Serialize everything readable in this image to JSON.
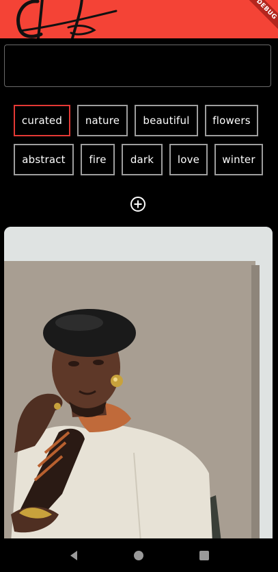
{
  "app_bar": {
    "color": "#f44336",
    "logo_icon": "script-logo-icon",
    "debug_banner": "DEBUG"
  },
  "search": {
    "value": "",
    "placeholder": ""
  },
  "tags": [
    {
      "label": "curated",
      "selected": true
    },
    {
      "label": "nature",
      "selected": false
    },
    {
      "label": "beautiful",
      "selected": false
    },
    {
      "label": "flowers",
      "selected": false
    },
    {
      "label": "abstract",
      "selected": false
    },
    {
      "label": "fire",
      "selected": false
    },
    {
      "label": "dark",
      "selected": false
    },
    {
      "label": "love",
      "selected": false
    },
    {
      "label": "winter",
      "selected": false
    }
  ],
  "add_tag_icon": "plus-circle-icon",
  "photo": {
    "subject_icon": "portrait-photo"
  },
  "nav": {
    "back_icon": "back-triangle-icon",
    "home_icon": "home-circle-icon",
    "recents_icon": "recents-square-icon"
  },
  "colors": {
    "accent": "#f44336",
    "selected_border": "#e53935",
    "tag_border": "#9e9e9e",
    "background": "#000000"
  }
}
